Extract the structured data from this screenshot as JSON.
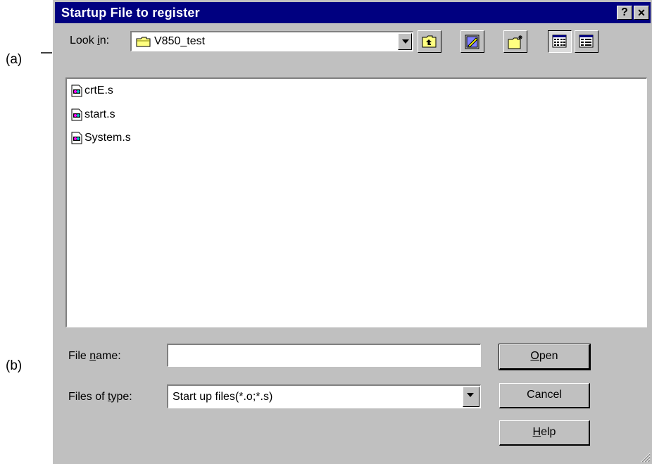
{
  "annotations": {
    "a": "(a)",
    "b": "(b)"
  },
  "dialog": {
    "title": "Startup File to register",
    "help_symbol": "?",
    "close_symbol": "✕"
  },
  "lookin": {
    "label_prefix": "Look ",
    "label_accel": "i",
    "label_suffix": "n:",
    "value": "V850_test",
    "folder_icon": "folder-icon"
  },
  "toolbar": {
    "up_one_level": "up-folder-icon",
    "desktop": "desktop-icon",
    "new_folder": "new-folder-icon",
    "list_view": "list-view-icon",
    "details_view": "details-view-icon"
  },
  "files": [
    {
      "name": "crtE.s",
      "icon": "asm-file-icon"
    },
    {
      "name": "start.s",
      "icon": "asm-file-icon"
    },
    {
      "name": "System.s",
      "icon": "asm-file-icon"
    }
  ],
  "filename": {
    "label_prefix": "File ",
    "label_accel": "n",
    "label_suffix": "ame:",
    "value": ""
  },
  "filetype": {
    "label_prefix": "Files of ",
    "label_accel": "t",
    "label_suffix": "ype:",
    "value": "Start up files(*.o;*.s)"
  },
  "buttons": {
    "open_accel": "O",
    "open_rest": "pen",
    "cancel": "Cancel",
    "help_accel": "H",
    "help_rest": "elp"
  },
  "colors": {
    "titlebar": "#000080",
    "face": "#c0c0c0"
  }
}
